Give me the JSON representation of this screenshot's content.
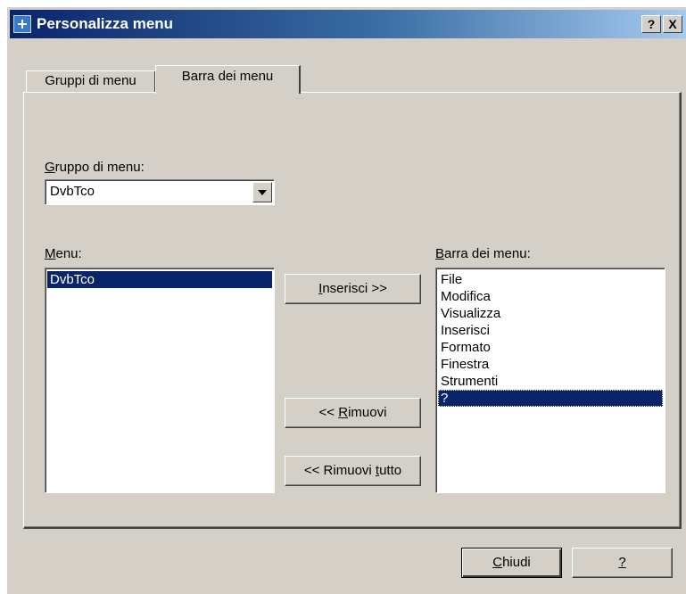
{
  "window": {
    "title": "Personalizza menu",
    "help_button": "?",
    "close_button": "X"
  },
  "tabs": [
    {
      "label": "Gruppi di menu",
      "active": false
    },
    {
      "label": "Barra dei menu",
      "active": true
    }
  ],
  "group": {
    "label_key": "G",
    "label_rest": "ruppo di menu:",
    "selected": "DvbTco"
  },
  "menu_list": {
    "label_key": "M",
    "label_rest": "enu:",
    "items": [
      "DvbTco"
    ],
    "selected_index": 0
  },
  "menubar_list": {
    "label_key": "B",
    "label_rest": "arra dei menu:",
    "items": [
      "File",
      "Modifica",
      "Visualizza",
      "Inserisci",
      "Formato",
      "Finestra",
      "Strumenti",
      "?"
    ],
    "selected_index": 7
  },
  "buttons": {
    "insert_key": "I",
    "insert_rest": "nserisci >>",
    "remove_pre": "<< ",
    "remove_key": "R",
    "remove_rest": "imuovi",
    "remove_all_pre": "<< Rimuovi ",
    "remove_all_key": "t",
    "remove_all_rest": "utto",
    "close_key": "C",
    "close_rest": "hiudi",
    "help": "?"
  },
  "colors": {
    "face": "#d4d0c8",
    "selection": "#0a246a",
    "title_start": "#0a246a",
    "title_end": "#a6caf0"
  }
}
